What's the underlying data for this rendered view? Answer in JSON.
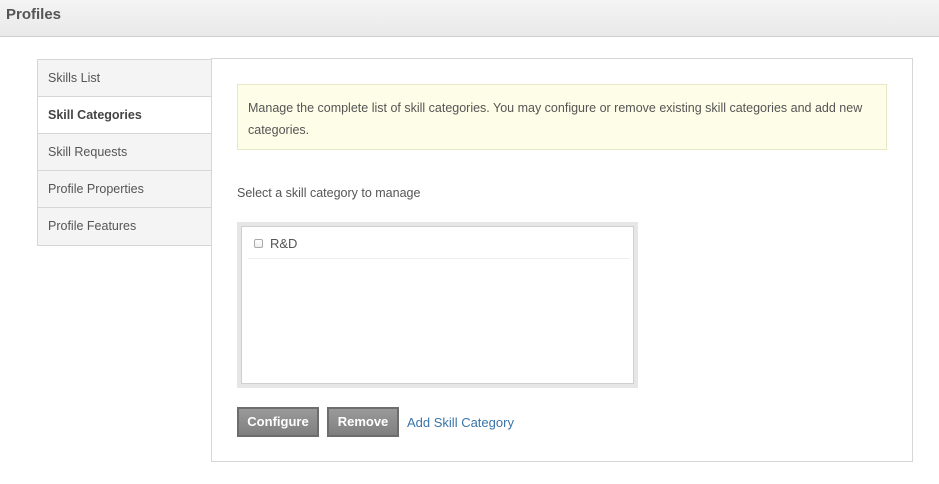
{
  "header": {
    "title": "Profiles"
  },
  "sidebar": {
    "items": [
      {
        "label": "Skills List"
      },
      {
        "label": "Skill Categories",
        "active": true
      },
      {
        "label": "Skill Requests"
      },
      {
        "label": "Profile Properties"
      },
      {
        "label": "Profile Features"
      }
    ]
  },
  "main": {
    "notice": "Manage the complete list of skill categories. You may configure or remove existing skill categories and add new categories.",
    "prompt": "Select a skill category to manage",
    "categories": [
      {
        "label": "R&D",
        "checked": false
      }
    ],
    "buttons": {
      "configure": "Configure",
      "remove": "Remove",
      "add_link": "Add Skill Category"
    }
  }
}
